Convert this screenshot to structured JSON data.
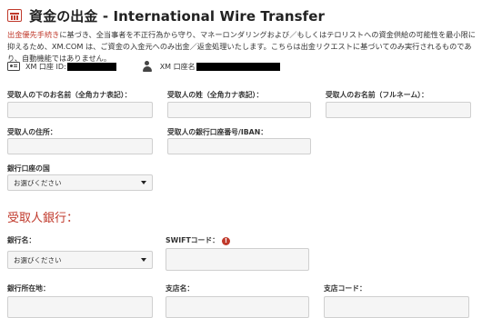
{
  "header": {
    "title": "資金の出金 - International Wire Transfer"
  },
  "notice": {
    "highlight": "出金優先手続き",
    "line1_rest": "に基づき、全当事者を不正行為から守り、マネーロンダリングおよび／もしくはテロリストへの資金供給の可能性を最小限に",
    "line2": "抑えるため、XM.COM は、ご資金の入金元へのみ出金／返金処理いたします。こちらは出金リクエストに基づいてのみ実行されるものであ",
    "line3": "り、自動機能ではありません。"
  },
  "account": {
    "id_label": "XM 口座 ID:",
    "name_label": "XM 口座名"
  },
  "beneficiary": {
    "first_name_label": "受取人の下のお名前（全角カナ表記）：",
    "last_name_label": "受取人の姓（全角カナ表記）：",
    "full_name_label": "受取人のお名前（フルネーム）：",
    "address_label": "受取人の住所：",
    "account_number_label": "受取人の銀行口座番号/IBAN：",
    "country_label": "銀行口座の国",
    "country_value": "お選びください"
  },
  "bank": {
    "section_title": "受取人銀行：",
    "bank_name_label": "銀行名：",
    "bank_name_value": "お選びください",
    "swift_label": "SWIFTコード：",
    "swift_info": "!",
    "bank_address_label": "銀行所在地：",
    "branch_name_label": "支店名：",
    "branch_code_label": "支店コード："
  },
  "colors": {
    "accent": "#c0392b",
    "input_bg": "#f5f5f5",
    "input_border": "#cfcfcf"
  }
}
